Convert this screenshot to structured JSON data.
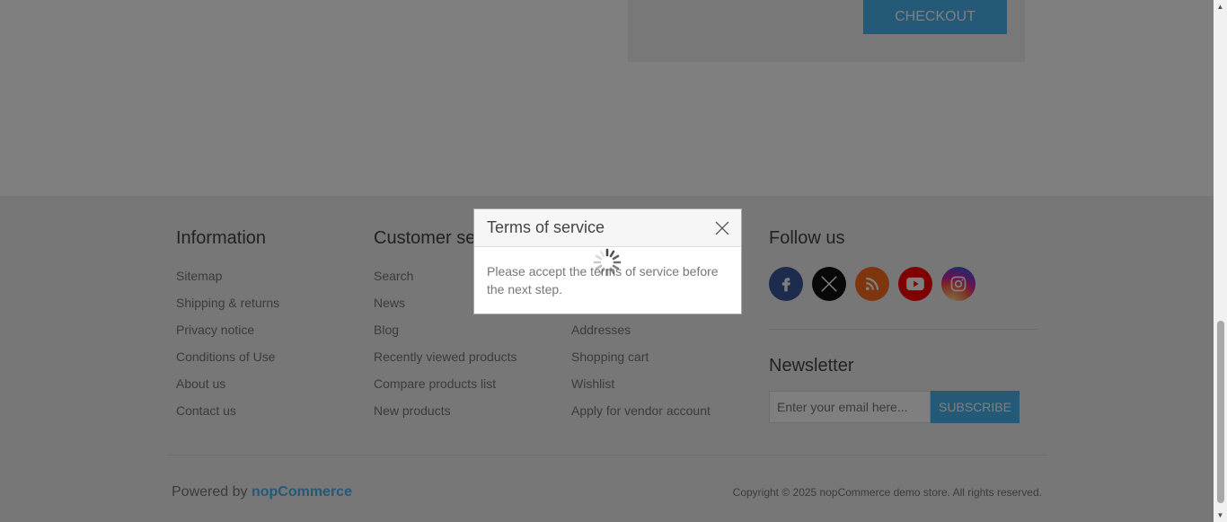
{
  "cart": {
    "checkout_label": "CHECKOUT"
  },
  "footer": {
    "information": {
      "title": "Information",
      "items": [
        "Sitemap",
        "Shipping & returns",
        "Privacy notice",
        "Conditions of Use",
        "About us",
        "Contact us"
      ]
    },
    "customer_service": {
      "title": "Customer service",
      "items": [
        "Search",
        "News",
        "Blog",
        "Recently viewed products",
        "Compare products list",
        "New products"
      ]
    },
    "my_account": {
      "items": [
        "Addresses",
        "Shopping cart",
        "Wishlist",
        "Apply for vendor account"
      ]
    },
    "follow_us": {
      "title": "Follow us",
      "icons": [
        "facebook-icon",
        "x-twitter-icon",
        "rss-icon",
        "youtube-icon",
        "instagram-icon"
      ],
      "colors": {
        "facebook": "#3b5998",
        "x": "#111111",
        "rss": "#fe6c1c",
        "youtube": "#ff0000"
      }
    },
    "newsletter": {
      "title": "Newsletter",
      "placeholder": "Enter your email here...",
      "subscribe_label": "SUBSCRIBE"
    },
    "powered_prefix": "Powered by",
    "powered_brand": "nopCommerce",
    "copyright": "Copyright © 2025 nopCommerce demo store. All rights reserved."
  },
  "dialog": {
    "title": "Terms of service",
    "message": "Please accept the terms of service before the next step."
  },
  "theme": {
    "accent": "#4ab2f1",
    "overlay": "rgba(0,0,0,0.5)"
  }
}
